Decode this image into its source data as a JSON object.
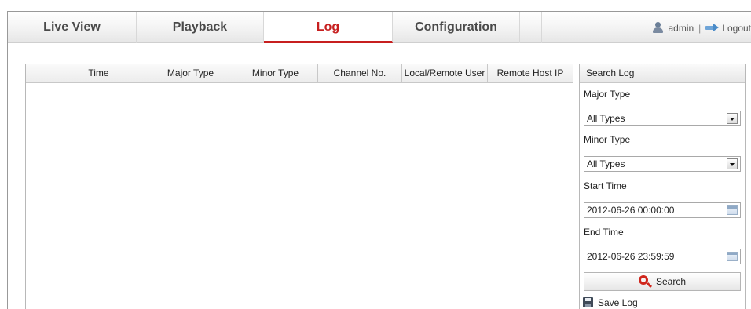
{
  "nav": {
    "tabs": [
      {
        "label": "Live View"
      },
      {
        "label": "Playback"
      },
      {
        "label": "Log",
        "active": true
      },
      {
        "label": "Configuration"
      }
    ],
    "username": "admin",
    "separator": "|",
    "logout_label": "Logout",
    "accent_color": "#c71f1f"
  },
  "log_table": {
    "columns": [
      "",
      "Time",
      "Major Type",
      "Minor Type",
      "Channel No.",
      "Local/Remote User",
      "Remote Host IP"
    ],
    "rows": []
  },
  "search_panel": {
    "title": "Search Log",
    "major_type_label": "Major Type",
    "major_type_value": "All Types",
    "minor_type_label": "Minor Type",
    "minor_type_value": "All Types",
    "start_time_label": "Start Time",
    "start_time_value": "2012-06-26 00:00:00",
    "end_time_label": "End Time",
    "end_time_value": "2012-06-26 23:59:59",
    "search_label": "Search",
    "save_log_label": "Save Log"
  },
  "icons": [
    "user-icon",
    "logout-icon",
    "dropdown-arrow-icon",
    "calendar-icon",
    "search-icon",
    "save-disk-icon"
  ]
}
